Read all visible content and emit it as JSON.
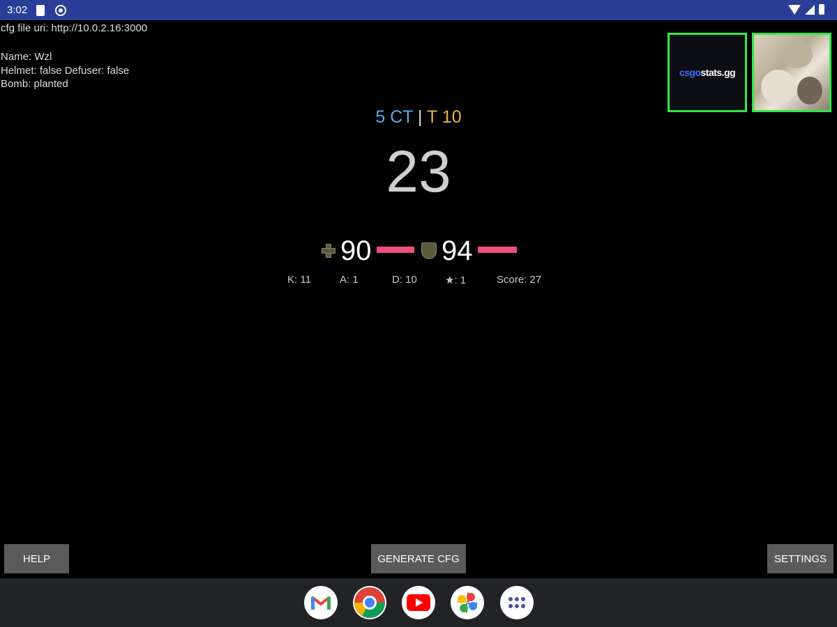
{
  "status_bar": {
    "time": "3:02"
  },
  "info": {
    "cfg_uri": "cfg file uri: http://10.0.2.16:3000",
    "name": "Name: Wzl",
    "equipment": "Helmet: false Defuser: false",
    "bomb": "Bomb: planted"
  },
  "thumbnails": {
    "csgo_part1": "csgo",
    "csgo_part2": "stats.gg"
  },
  "score": {
    "ct": "5 CT",
    "separator": " | ",
    "t": "T 10",
    "round_time": "23"
  },
  "vitals": {
    "health": "90",
    "health_level": 0.9,
    "armor": "94",
    "armor_level": 0.94
  },
  "stats": {
    "kills": "K: 11",
    "assists": "A: 1",
    "deaths": "D: 10",
    "mvps": "★: 1",
    "score": "Score: 27"
  },
  "buttons": {
    "help": "HELP",
    "generate": "GENERATE CFG",
    "settings": "SETTINGS"
  },
  "dock": {
    "apps": [
      "gmail-icon",
      "chrome-icon",
      "youtube-icon",
      "photos-icon",
      "app-drawer-icon"
    ]
  },
  "colors": {
    "ct": "#4fb0e8",
    "t": "#e8b63a",
    "bar": "#ee4f7c",
    "thumb_border": "#2ee84a"
  }
}
